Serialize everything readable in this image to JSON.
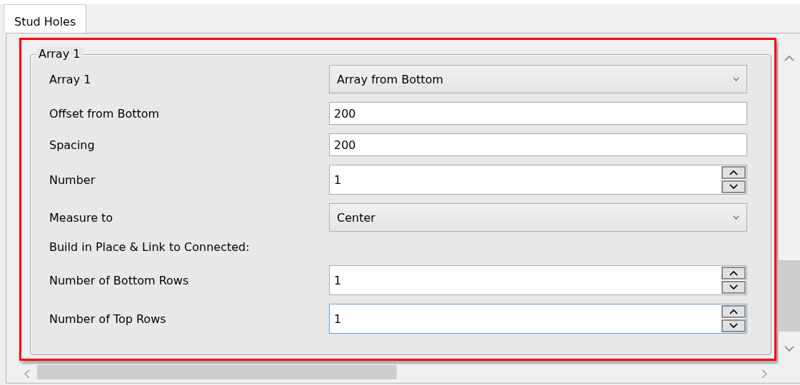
{
  "tabs": [
    {
      "label": "Stud Holes",
      "selected": true
    }
  ],
  "group": {
    "title": "Array 1",
    "highlighted": true,
    "rows": [
      {
        "kind": "dropdown",
        "label": "Array 1",
        "value": "Array from Bottom"
      },
      {
        "kind": "text",
        "label": "Offset from Bottom",
        "value": "200",
        "focused": false
      },
      {
        "kind": "text",
        "label": "Spacing",
        "value": "200",
        "focused": false
      },
      {
        "kind": "spinner",
        "label": "Number",
        "value": "1",
        "focused": false
      },
      {
        "kind": "dropdown",
        "label": "Measure to",
        "value": "Center"
      },
      {
        "kind": "heading",
        "label": "Build in Place & Link to Connected:"
      },
      {
        "kind": "spinner",
        "label": "Number of Bottom Rows",
        "value": "1",
        "focused": false
      },
      {
        "kind": "spinner",
        "label": "Number of Top Rows",
        "value": "1",
        "focused": true
      }
    ]
  }
}
